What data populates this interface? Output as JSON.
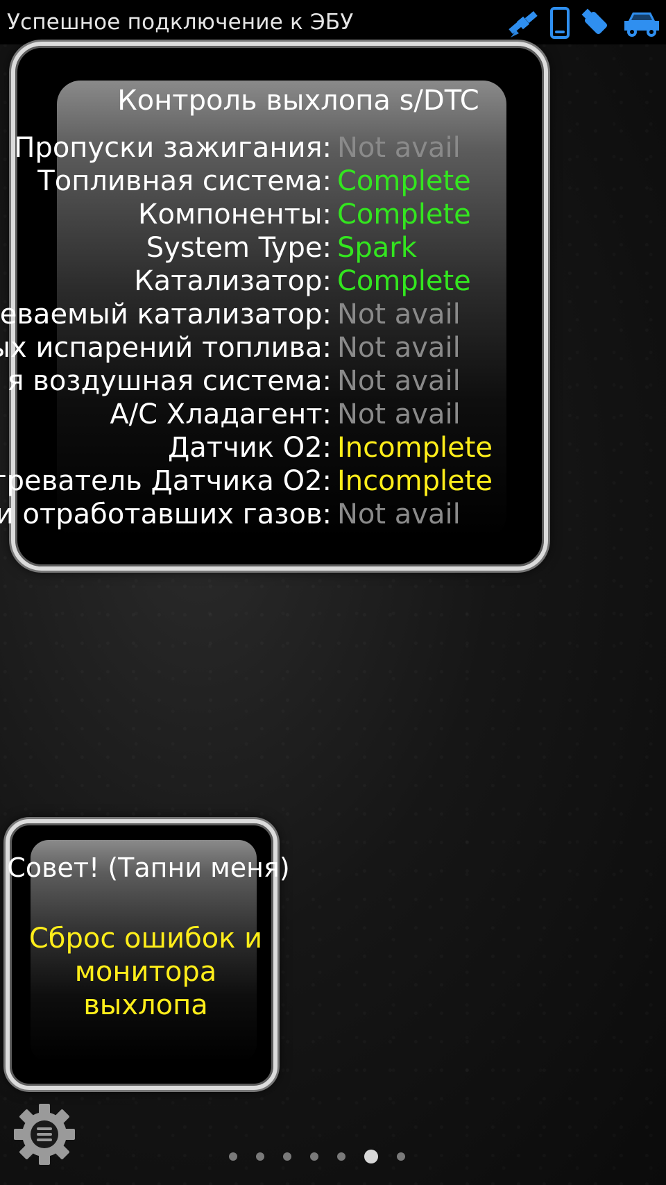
{
  "status": {
    "text": "Успешное подключение к ЭБУ",
    "icons": [
      "satellite-icon",
      "phone-icon",
      "usb-stick-icon",
      "car-icon"
    ],
    "icon_color": "#2f8ff0"
  },
  "monitor": {
    "title": "Контроль выхлопа s/DTC",
    "rows": [
      {
        "label": "Пропуски зажигания:",
        "value": "Not avail",
        "status": "na"
      },
      {
        "label": "Топливная система:",
        "value": "Complete",
        "status": "ok"
      },
      {
        "label": "Компоненты:",
        "value": "Complete",
        "status": "ok"
      },
      {
        "label": "System Type:",
        "value": "Spark",
        "status": "ok"
      },
      {
        "label": "Катализатор:",
        "value": "Complete",
        "status": "ok"
      },
      {
        "label": "еваемый катализатор:",
        "value": "Not avail",
        "status": "na"
      },
      {
        "label": "ых испарений топлива:",
        "value": "Not avail",
        "status": "na"
      },
      {
        "label": "я воздушная система:",
        "value": "Not avail",
        "status": "na"
      },
      {
        "label": "A/C Хладагент:",
        "value": "Not avail",
        "status": "na"
      },
      {
        "label": "Датчик O2:",
        "value": "Incomplete",
        "status": "inc"
      },
      {
        "label": "греватель Датчика O2:",
        "value": "Incomplete",
        "status": "inc"
      },
      {
        "label": "и отработавших газов:",
        "value": "Not avail",
        "status": "na"
      }
    ],
    "colors": {
      "ok": "#33e61f",
      "inc": "#ffee1a",
      "na": "#8a8a8a"
    }
  },
  "tip": {
    "title": "Совет! (Тапни меня)",
    "body": "Сброс ошибок и монитора выхлопа"
  },
  "pager": {
    "count": 7,
    "active": 6
  },
  "settings": {
    "icon": "gear-menu-icon"
  }
}
